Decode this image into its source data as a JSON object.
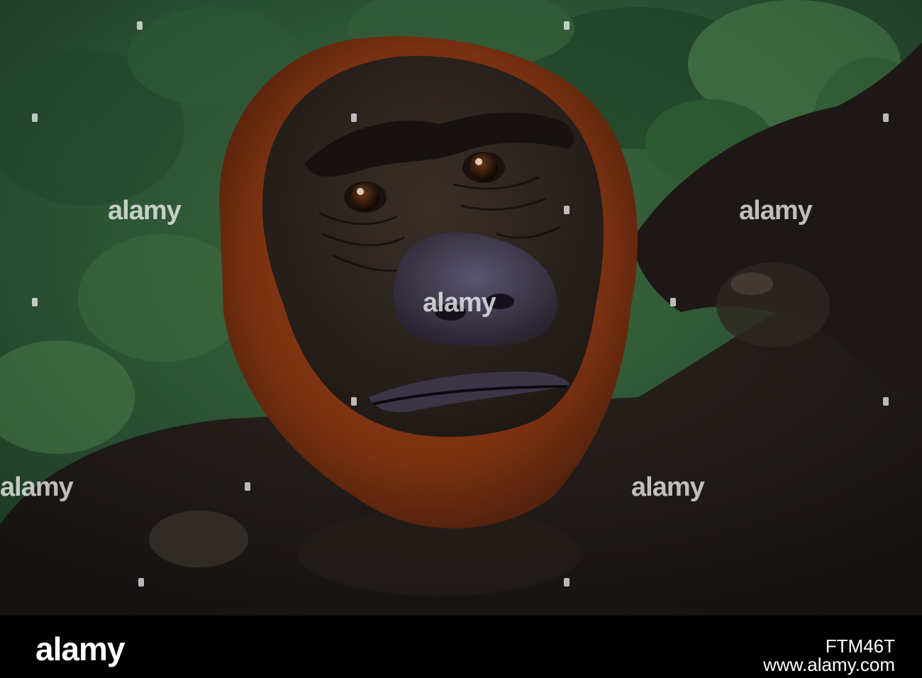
{
  "photo": {
    "subject": "gorilla-face",
    "background_color": "#2f5a36",
    "fur_color": "#8a3a14",
    "skin_color": "#2a221d"
  },
  "watermark": {
    "text": "alamy"
  },
  "footer": {
    "logo": "alamy",
    "image_id": "FTM46T",
    "url": "www.alamy.com"
  }
}
